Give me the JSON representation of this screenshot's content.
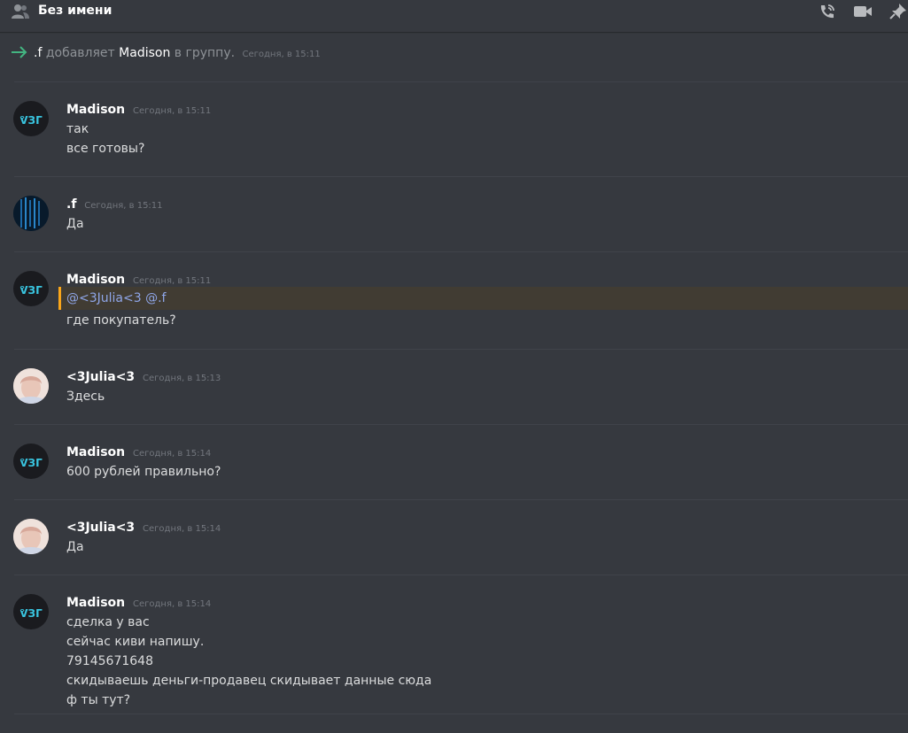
{
  "header": {
    "title": "Без имени",
    "icons": [
      "people-icon",
      "phone-call-icon",
      "video-icon",
      "pin-icon"
    ]
  },
  "system": {
    "actor": ".f",
    "verb": "добавляет",
    "target": "Madison",
    "suffix": "в группу.",
    "timestamp": "Сегодня, в 15:11"
  },
  "messages": [
    {
      "author": "Madison",
      "timestamp": "Сегодня, в 15:11",
      "lines": [
        "так",
        "все готовы?"
      ]
    },
    {
      "author": ".f",
      "timestamp": "Сегодня, в 15:11",
      "lines": [
        "Да"
      ]
    },
    {
      "author": "Madison",
      "timestamp": "Сегодня, в 15:11",
      "mentions": [
        "@<3Julia<3",
        "@.f"
      ],
      "lines": [
        "где покупатель?"
      ]
    },
    {
      "author": "<3Julia<3",
      "timestamp": "Сегодня, в 15:13",
      "lines": [
        "Здесь"
      ]
    },
    {
      "author": "Madison",
      "timestamp": "Сегодня, в 15:14",
      "lines": [
        "600 рублей правильно?"
      ]
    },
    {
      "author": "<3Julia<3",
      "timestamp": "Сегодня, в 15:14",
      "lines": [
        "Да"
      ]
    },
    {
      "author": "Madison",
      "timestamp": "Сегодня, в 15:14",
      "lines": [
        "сделка у вас",
        "сейчас киви напишу.",
        "79145671648",
        "скидываешь деньги-продавец скидывает данные сюда",
        "ф ты тут?"
      ]
    }
  ],
  "colors": {
    "background": "#36393f",
    "mention_highlight": "#413c33",
    "mention_bar": "#faa61a",
    "mention_text": "#8fa6e8",
    "system_arrow": "#43b581"
  }
}
